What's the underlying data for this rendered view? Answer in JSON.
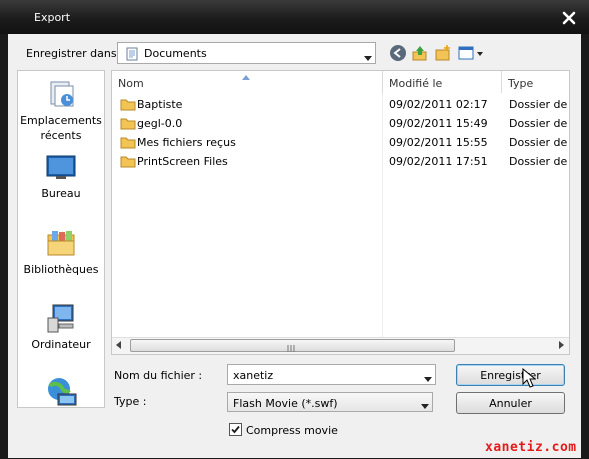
{
  "window": {
    "title": "Export"
  },
  "toolbar": {
    "save_in_label": "Enregistrer dans :",
    "location": "Documents"
  },
  "places": [
    {
      "label": "Emplacements\nrécents",
      "icon": "recent-places-icon"
    },
    {
      "label": "Bureau",
      "icon": "desktop-icon"
    },
    {
      "label": "Bibliothèques",
      "icon": "libraries-icon"
    },
    {
      "label": "Ordinateur",
      "icon": "computer-icon"
    },
    {
      "label": "",
      "icon": "network-icon"
    }
  ],
  "list": {
    "columns": [
      "Nom",
      "Modifié le",
      "Type"
    ],
    "rows": [
      {
        "name": "Baptiste",
        "modified": "09/02/2011 02:17",
        "type": "Dossier de f"
      },
      {
        "name": "gegl-0.0",
        "modified": "09/02/2011 15:49",
        "type": "Dossier de f"
      },
      {
        "name": "Mes fichiers reçus",
        "modified": "09/02/2011 15:55",
        "type": "Dossier de f"
      },
      {
        "name": "PrintScreen Files",
        "modified": "09/02/2011 17:51",
        "type": "Dossier de f"
      }
    ]
  },
  "form": {
    "filename_label": "Nom du fichier :",
    "filename_value": "xanetiz",
    "type_label": "Type :",
    "type_value": "Flash Movie (*.swf)",
    "compress_label": "Compress movie",
    "compress_checked": true,
    "save_button": "Enregistrer",
    "cancel_button": "Annuler"
  },
  "watermark": "xanetiz.com",
  "colors": {
    "folder": "#f2c455",
    "title_bar": "#1c1c1c",
    "accent_blue": "#2f6fbf"
  }
}
